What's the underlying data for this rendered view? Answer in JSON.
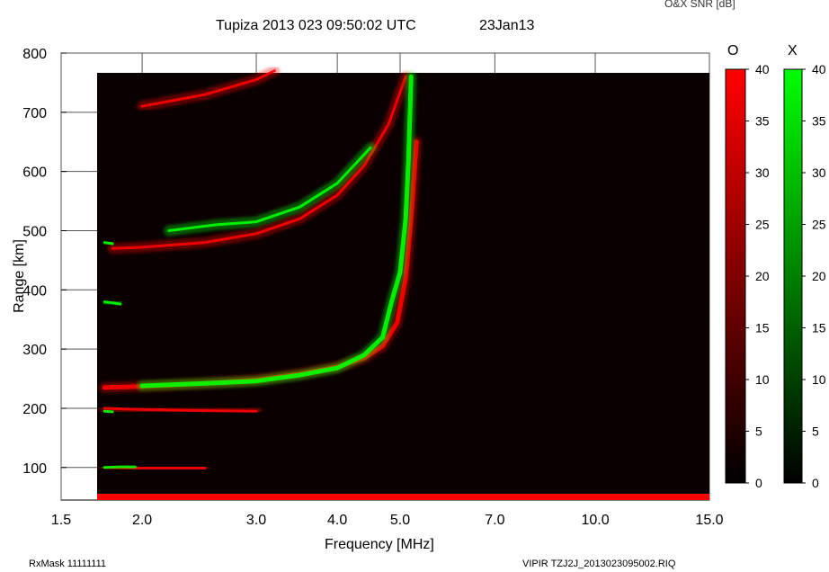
{
  "header": {
    "title": "Tupiza 2013 023 09:50:02 UTC",
    "date": "23Jan13",
    "snr_label": "O&X SNR [dB]"
  },
  "footer": {
    "rx_mask": "RxMask 11111111",
    "file": "VIPIR  TZJ2J_2013023095002.RIQ"
  },
  "colorbars": {
    "o": {
      "label": "O",
      "color": "#ff0000",
      "range": [
        0,
        40
      ],
      "ticks": [
        "40",
        "35",
        "30",
        "25",
        "20",
        "15",
        "10",
        "5",
        "0"
      ]
    },
    "x": {
      "label": "X",
      "color": "#00ff00",
      "range": [
        0,
        40
      ],
      "ticks": [
        "40",
        "35",
        "30",
        "25",
        "20",
        "15",
        "10",
        "5",
        "0"
      ]
    }
  },
  "chart_data": {
    "type": "scatter",
    "title": "Tupiza 2013 023 09:50:02 UTC",
    "xlabel": "Frequency [MHz]",
    "ylabel": "Range [km]",
    "x_scale": "log",
    "xlim": [
      1.5,
      15.0
    ],
    "ylim": [
      45,
      800
    ],
    "x_ticks": [
      "1.5",
      "2.0",
      "3.0",
      "4.0",
      "5.0",
      "7.0",
      "10.0",
      "15.0"
    ],
    "y_ticks": [
      "100",
      "200",
      "300",
      "400",
      "500",
      "600",
      "700",
      "800"
    ],
    "grid": true,
    "series": [
      {
        "name": "O",
        "color": "#ff0000",
        "traces": [
          {
            "x": [
              1.75,
              2.0,
              2.5,
              3.0,
              3.5,
              4.0,
              4.4,
              4.7,
              4.95,
              5.1,
              5.2,
              5.3
            ],
            "y": [
              235,
              237,
              242,
              248,
              258,
              270,
              285,
              305,
              345,
              420,
              520,
              650
            ]
          },
          {
            "x": [
              1.8,
              2.0,
              2.5,
              3.0,
              3.5,
              4.0,
              4.4,
              4.8,
              5.1
            ],
            "y": [
              470,
              472,
              480,
              495,
              520,
              560,
              610,
              680,
              760
            ]
          },
          {
            "x": [
              1.75,
              2.0,
              2.3,
              2.5
            ],
            "y": [
              100,
              99,
              99,
              99
            ]
          },
          {
            "x": [
              1.75,
              2.0,
              2.5,
              3.0
            ],
            "y": [
              200,
              198,
              196,
              195
            ]
          },
          {
            "x": [
              2.0,
              2.5,
              3.0,
              3.2
            ],
            "y": [
              710,
              730,
              755,
              770
            ]
          }
        ]
      },
      {
        "name": "X",
        "color": "#00ff00",
        "traces": [
          {
            "x": [
              2.0,
              2.5,
              3.0,
              3.5,
              4.0,
              4.4,
              4.7,
              4.85,
              5.0,
              5.1,
              5.15,
              5.2
            ],
            "y": [
              238,
              242,
              246,
              256,
              268,
              290,
              320,
              380,
              430,
              520,
              620,
              760
            ]
          },
          {
            "x": [
              1.75,
              1.8,
              1.85
            ],
            "y": [
              380,
              378,
              376
            ]
          },
          {
            "x": [
              1.75,
              1.85,
              1.95
            ],
            "y": [
              100,
              101,
              101
            ]
          },
          {
            "x": [
              1.75,
              1.8
            ],
            "y": [
              195,
              194
            ]
          },
          {
            "x": [
              1.75,
              1.8
            ],
            "y": [
              480,
              478
            ]
          },
          {
            "x": [
              2.2,
              2.6,
              3.0,
              3.5,
              4.0,
              4.5
            ],
            "y": [
              500,
              510,
              515,
              540,
              580,
              640
            ]
          }
        ]
      }
    ]
  }
}
